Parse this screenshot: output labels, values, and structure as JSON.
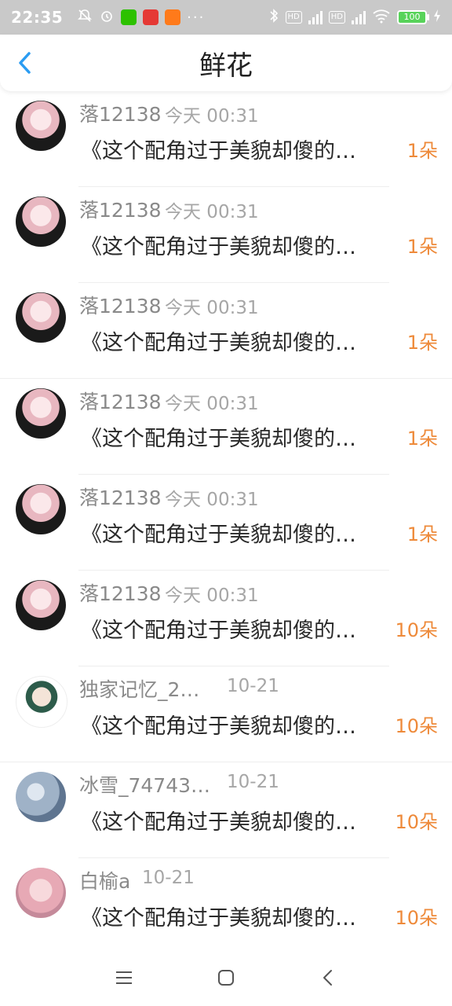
{
  "status": {
    "time": "22:35",
    "battery": "100",
    "icons": [
      "mute-icon",
      "alarm-icon",
      "wechat-icon",
      "app-icon",
      "app-icon",
      "more-dots-icon",
      "bluetooth-icon",
      "hd-icon",
      "signal-icon",
      "wifi-icon",
      "battery-icon",
      "charging-icon"
    ]
  },
  "header": {
    "title": "鲜花",
    "back_icon": "chevron-left-icon",
    "accent": "#2a9cf2"
  },
  "items": [
    {
      "name": "落12138",
      "time": "今天 00:31",
      "text": "《这个配角过于美貌却傻的…",
      "amount": "1朵",
      "avatar": "pink"
    },
    {
      "name": "落12138",
      "time": "今天 00:31",
      "text": "《这个配角过于美貌却傻的…",
      "amount": "1朵",
      "avatar": "pink"
    },
    {
      "name": "落12138",
      "time": "今天 00:31",
      "text": "《这个配角过于美貌却傻的…",
      "amount": "1朵",
      "avatar": "pink"
    },
    {
      "name": "落12138",
      "time": "今天 00:31",
      "text": "《这个配角过于美貌却傻的…",
      "amount": "1朵",
      "avatar": "pink"
    },
    {
      "name": "落12138",
      "time": "今天 00:31",
      "text": "《这个配角过于美貌却傻的…",
      "amount": "1朵",
      "avatar": "pink"
    },
    {
      "name": "落12138",
      "time": "今天 00:31",
      "text": "《这个配角过于美貌却傻的…",
      "amount": "10朵",
      "avatar": "pink"
    },
    {
      "name": "独家记忆_2…",
      "time": "10-21",
      "text": "《这个配角过于美貌却傻的…",
      "amount": "10朵",
      "avatar": "boy"
    },
    {
      "name": "冰雪_74743…",
      "time": "10-21",
      "text": "《这个配角过于美貌却傻的…",
      "amount": "10朵",
      "avatar": "sky"
    },
    {
      "name": "白榆a",
      "time": "10-21",
      "text": "《这个配角过于美貌却傻的…",
      "amount": "10朵",
      "avatar": "girl"
    }
  ],
  "colors": {
    "amount": "#ee8a3a",
    "name": "#8a8a8a",
    "time": "#a6a6a6"
  },
  "navbar": {
    "icons": [
      "menu-icon",
      "home-square-icon",
      "back-icon"
    ]
  }
}
